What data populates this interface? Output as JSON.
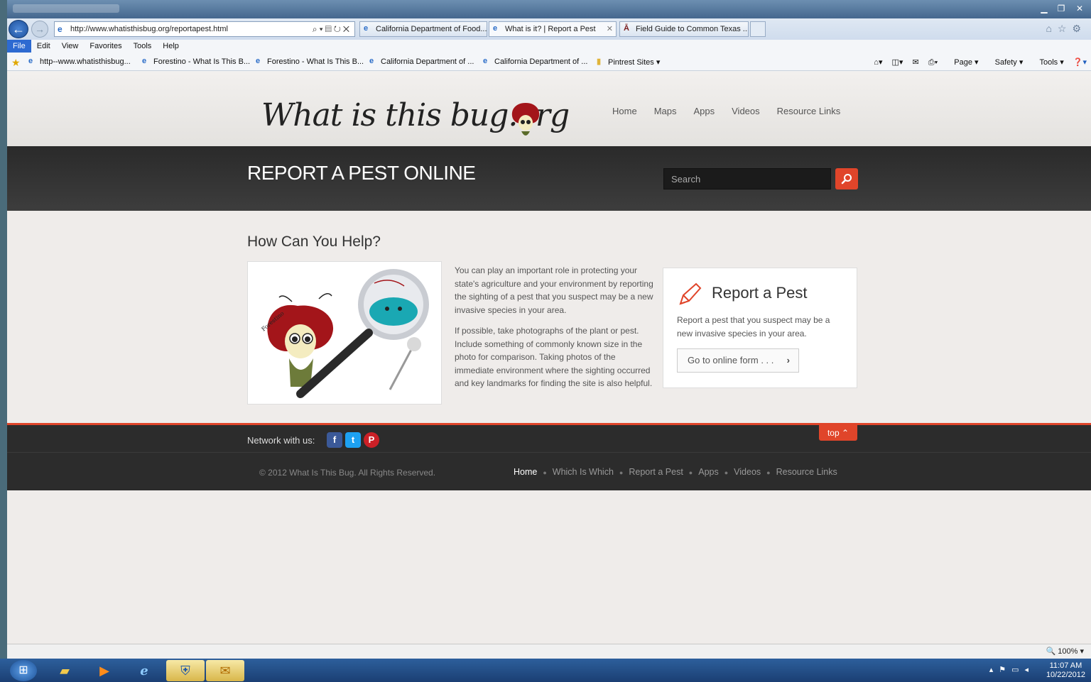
{
  "browser": {
    "url": "http://www.whatisthisbug.org/reportapest.html",
    "tabs": [
      {
        "label": "California Department of Food...",
        "active": false
      },
      {
        "label": "What is it? | Report a Pest",
        "active": true
      },
      {
        "label": "Field Guide to Common Texas ...",
        "active": false
      }
    ],
    "menu": [
      "File",
      "Edit",
      "View",
      "Favorites",
      "Tools",
      "Help"
    ],
    "favorites": [
      "http--www.whatisthisbug...",
      "Forestino - What Is This B...",
      "Forestino - What Is This B...",
      "California Department of ...",
      "California Department of ...",
      "Pintrest Sites"
    ],
    "commands": [
      "Page",
      "Safety",
      "Tools"
    ],
    "zoom": "100%"
  },
  "site": {
    "logo": "What is this bug.org",
    "nav": [
      "Home",
      "Maps",
      "Apps",
      "Videos",
      "Resource Links"
    ],
    "banner_title": "REPORT A PEST ONLINE",
    "search_placeholder": "Search",
    "help_title": "How Can You Help?",
    "illustration_label": "Forestino",
    "para1": "You can play an important role in protecting your state's agriculture and your environment by reporting the sighting of a pest that you suspect may be a new invasive species in your area.",
    "para2": "If possible, take photographs of the plant or pest. Include something of commonly known size in the photo for comparison. Taking photos of the immediate environment where the sighting occurred and key landmarks for finding the site is also helpful.",
    "report_title": "Report a Pest",
    "report_text": "Report a pest that you suspect may be a new invasive species in your area.",
    "form_button": "Go to online form . . .",
    "network_label": "Network with us:",
    "top_label": "top",
    "copyright": "© 2012 What Is This Bug. All Rights Reserved.",
    "footer_nav": [
      "Home",
      "Which Is Which",
      "Report a Pest",
      "Apps",
      "Videos",
      "Resource Links"
    ]
  },
  "taskbar": {
    "time": "11:07 AM",
    "date": "10/22/2012"
  },
  "colors": {
    "accent": "#e0452a",
    "banner": "#333333",
    "footer": "#2c2c2c"
  }
}
